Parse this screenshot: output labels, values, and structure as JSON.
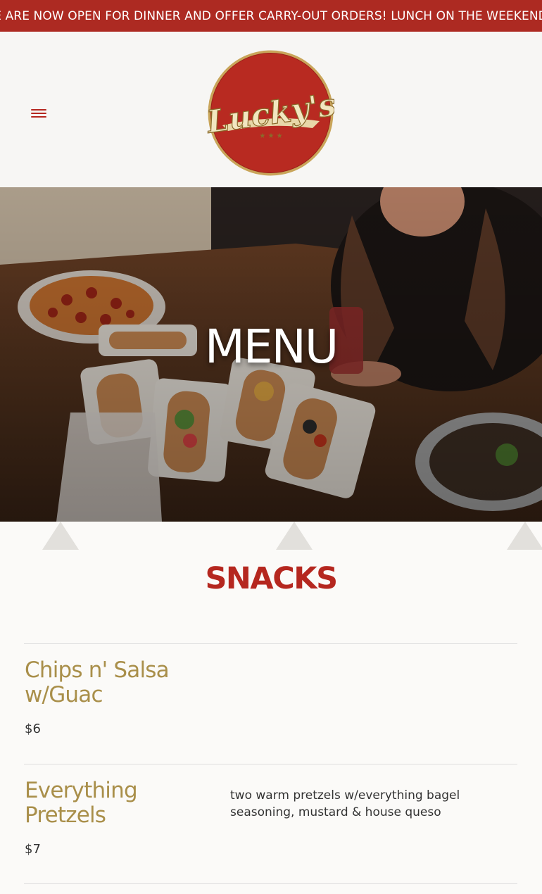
{
  "announcement": "WE ARE NOW OPEN FOR DINNER AND OFFER CARRY-OUT ORDERS! LUNCH ON THE WEEKENDS!",
  "logo_text": "Lucky's",
  "hero_title": "MENU",
  "section_title": "SNACKS",
  "menu_items": [
    {
      "name": "Chips n' Salsa w/Guac",
      "price": "$6",
      "description": ""
    },
    {
      "name": "Everything Pretzels",
      "price": "$7",
      "description": "two warm pretzels w/everything bagel seasoning, mustard & house queso"
    }
  ],
  "colors": {
    "brand_red": "#b5271f",
    "announcement_bg": "#ad2a22",
    "gold": "#a98f4a",
    "header_bg": "#f7f6f4"
  },
  "icons": [
    "hamburger-menu-icon"
  ]
}
